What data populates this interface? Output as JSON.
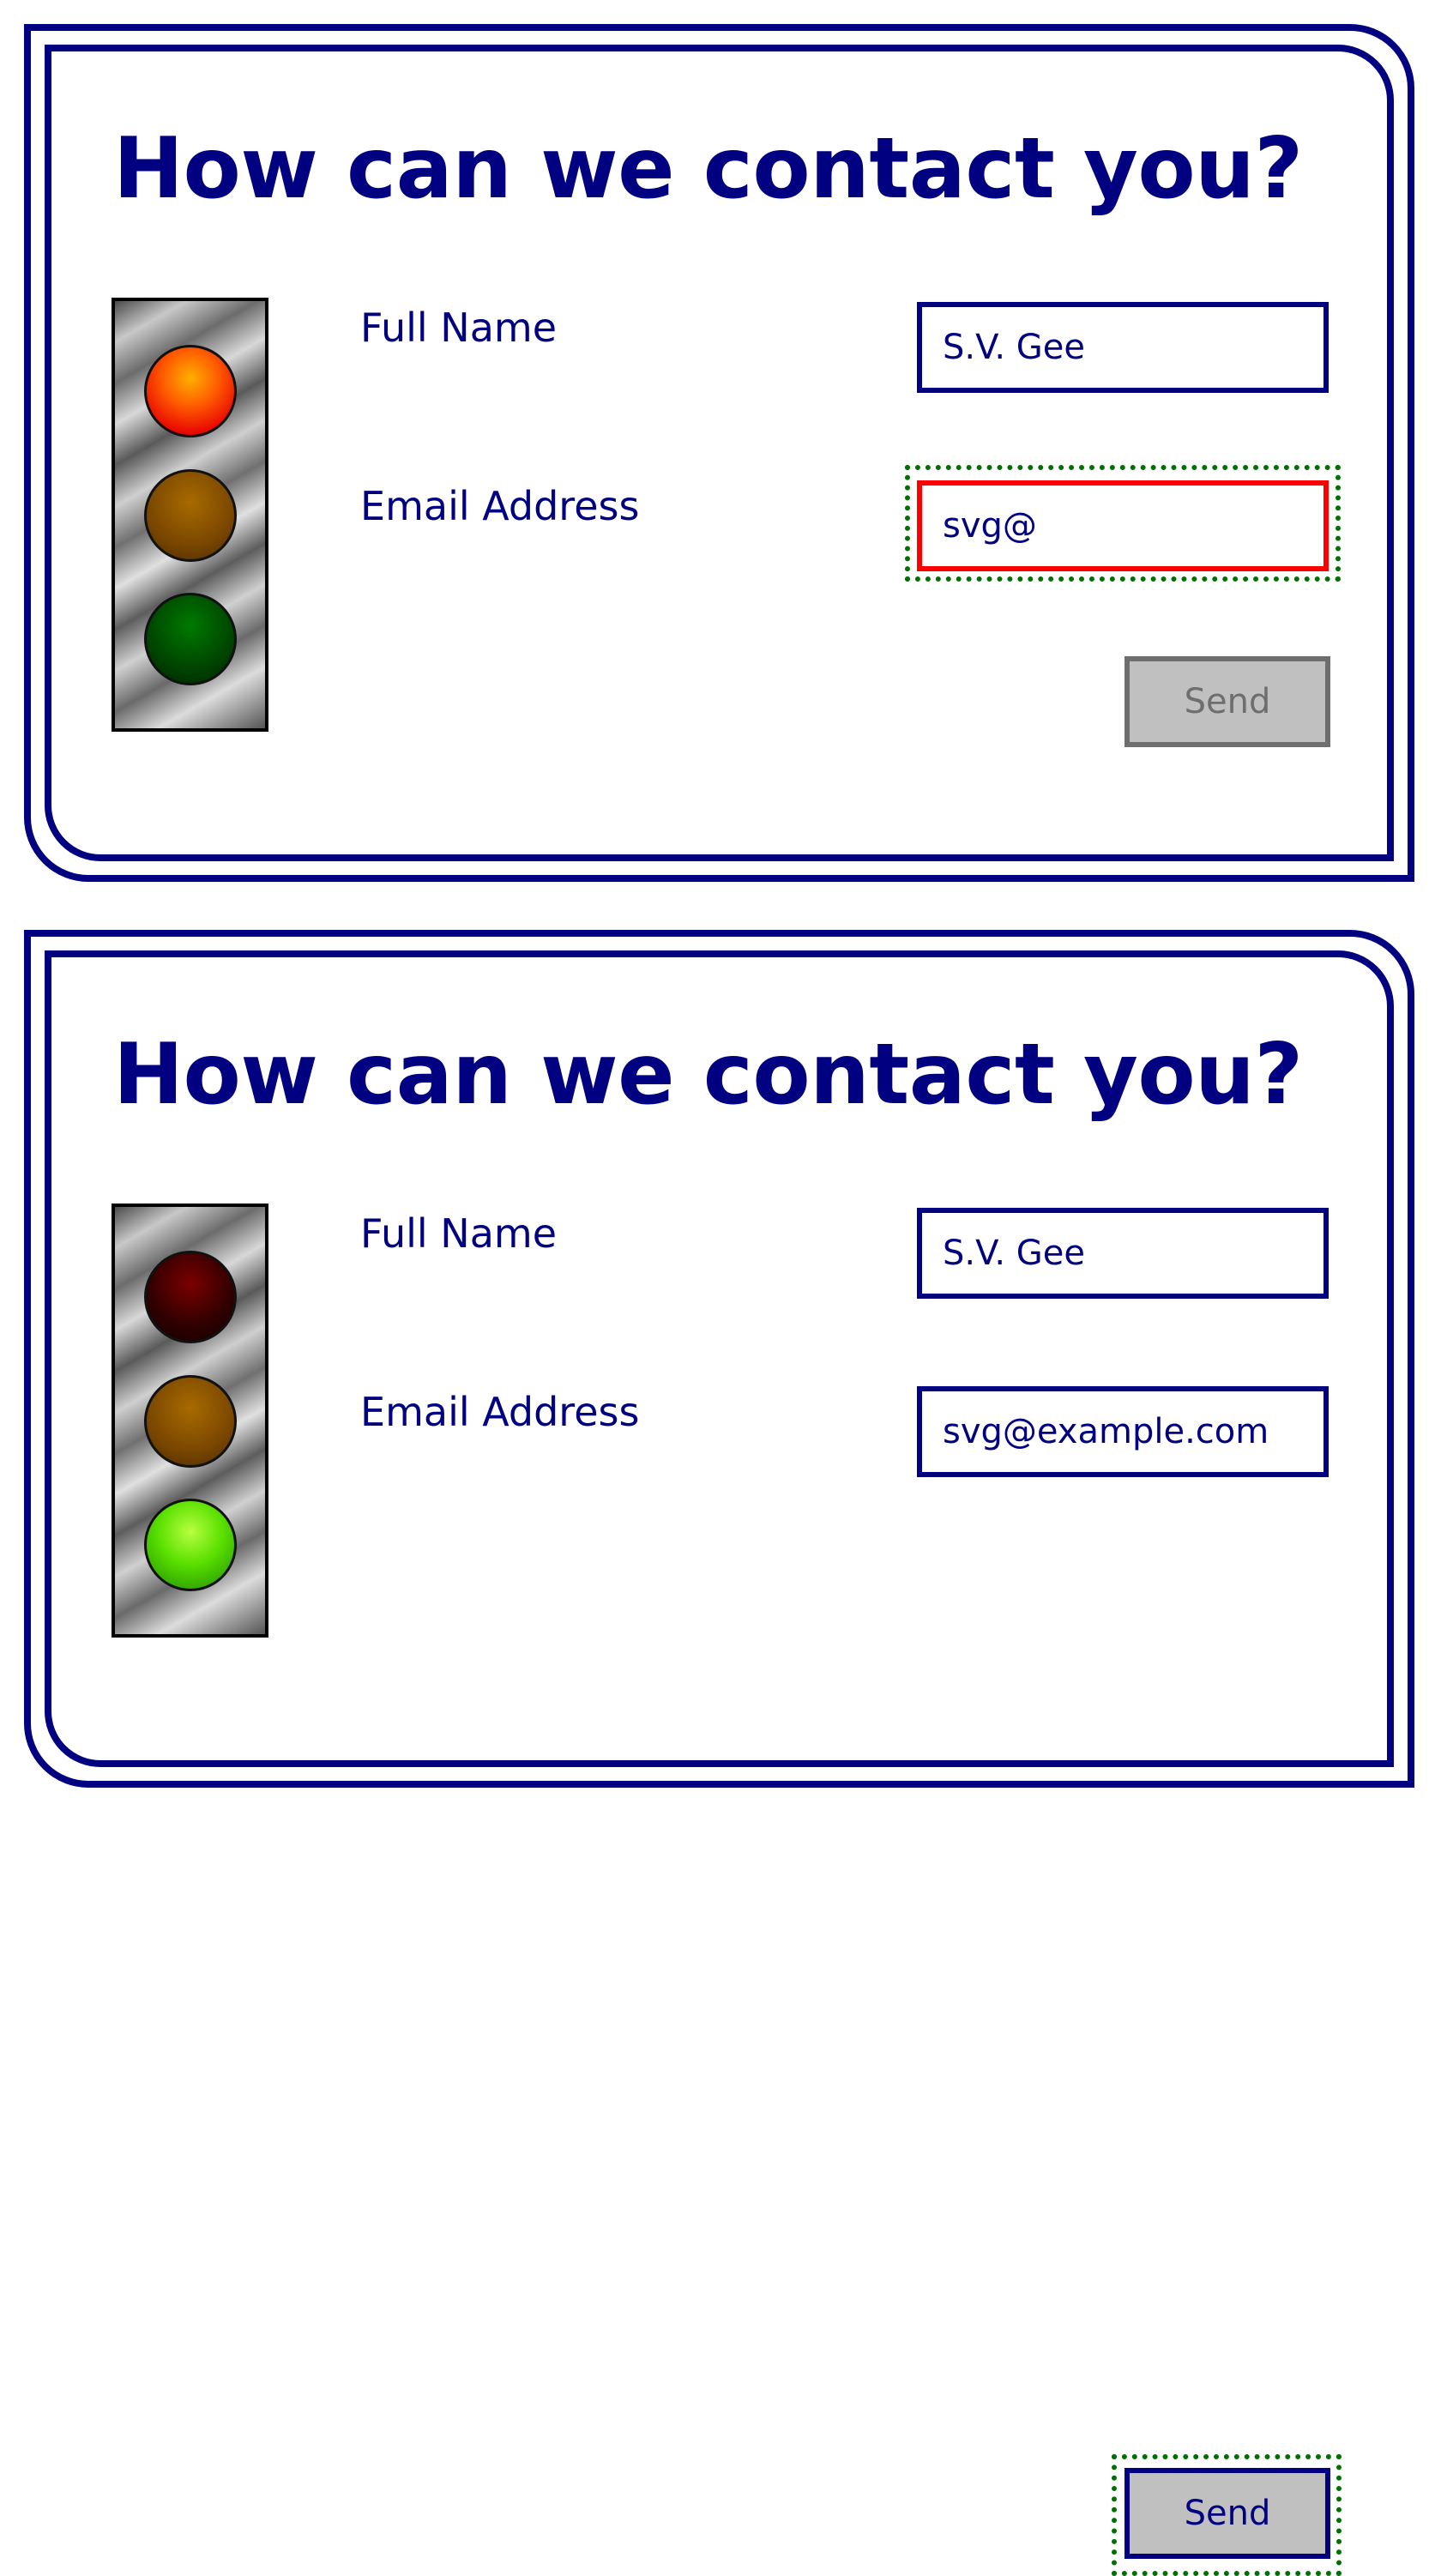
{
  "panels": [
    {
      "title": "How can we contact you?",
      "labels": {
        "full_name": "Full Name",
        "email": "Email Address"
      },
      "fields": {
        "full_name_value": "S.V. Gee",
        "email_value": "svg@"
      },
      "email_state": "invalid",
      "focus": "email-field",
      "send_label": "Send",
      "send_state": "disabled",
      "traffic_light": {
        "red": "on",
        "amber": "off",
        "green": "off"
      }
    },
    {
      "title": "How can we contact you?",
      "labels": {
        "full_name": "Full Name",
        "email": "Email Address"
      },
      "fields": {
        "full_name_value": "S.V. Gee",
        "email_value": "svg@example.com"
      },
      "email_state": "valid",
      "focus": "send-button",
      "send_label": "Send",
      "send_state": "enabled",
      "traffic_light": {
        "red": "off",
        "amber": "off",
        "green": "on"
      }
    }
  ],
  "colors": {
    "text": "#000080",
    "frame": "#000080",
    "invalid_border": "#ff0000",
    "focus_ring": "#007000",
    "button_face": "#c0c0c0",
    "button_disabled": "#6e6e6e"
  }
}
